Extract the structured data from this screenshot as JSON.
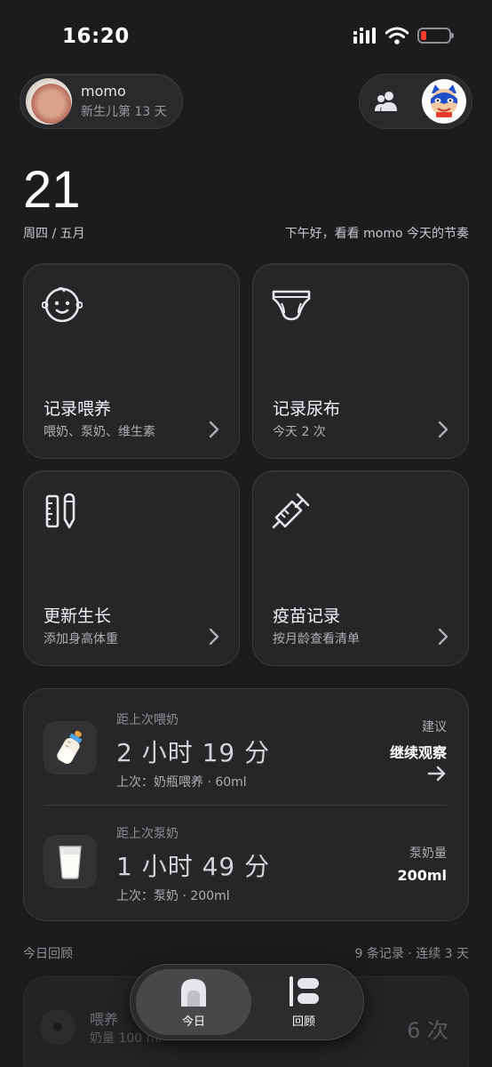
{
  "status_bar": {
    "time": "16:20",
    "battery_level": 0.2,
    "battery_color": "#ff3b30"
  },
  "profile": {
    "name": "momo",
    "subtitle": "新生儿第 13 天"
  },
  "header_right": {
    "family_icon": "people-icon",
    "avatar_icon": "cat-mask-avatar"
  },
  "date": {
    "day": "21",
    "weekday_month": "周四 / 五月",
    "greeting": "下午好，看看 momo 今天的节奏"
  },
  "cards": [
    {
      "icon": "baby-face-icon",
      "title": "记录喂养",
      "subtitle": "喂奶、泵奶、维生素"
    },
    {
      "icon": "diaper-icon",
      "title": "记录尿布",
      "subtitle": "今天 2 次"
    },
    {
      "icon": "ruler-pencil-icon",
      "title": "更新生长",
      "subtitle": "添加身高体重"
    },
    {
      "icon": "syringe-icon",
      "title": "疫苗记录",
      "subtitle": "按月龄查看清单"
    }
  ],
  "stats": {
    "feed": {
      "icon": "baby-bottle-icon",
      "label": "距上次喂奶",
      "value": "2 小时 19 分",
      "last": "上次：奶瓶喂养 · 60ml",
      "right_label": "建议",
      "right_value": "继续观察"
    },
    "pump": {
      "icon": "milk-glass-icon",
      "label": "距上次泵奶",
      "value": "1 小时 49 分",
      "last": "上次：泵奶 · 200ml",
      "right_label": "泵奶量",
      "right_value": "200ml"
    }
  },
  "review": {
    "label": "今日回顾",
    "summary": "9 条记录 · 连续 3 天",
    "item": {
      "title": "喂养",
      "subtitle": "奶量 100 ml",
      "count": "6 次"
    }
  },
  "tabs": [
    {
      "label": "今日",
      "icon": "home-icon",
      "active": true
    },
    {
      "label": "回顾",
      "icon": "timeline-icon",
      "active": false
    }
  ]
}
